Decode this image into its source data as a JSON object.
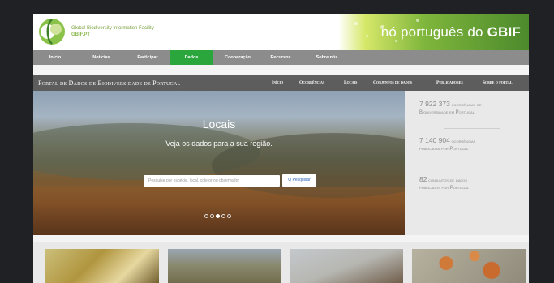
{
  "header": {
    "org_name": "Global Biodiversity Information Facility",
    "org_short": "GBIF.PT",
    "banner_text": "nó português do",
    "banner_brand": "GBIF",
    "colors": {
      "brand_green": "#2aa63c",
      "banner_green": "#4c8a2c"
    }
  },
  "main_nav": {
    "items": [
      {
        "label": "Início"
      },
      {
        "label": "Notícias"
      },
      {
        "label": "Participar"
      },
      {
        "label": "Dados"
      },
      {
        "label": "Cooperação"
      },
      {
        "label": "Recursos"
      },
      {
        "label": "Sobre nós"
      }
    ],
    "active_label": "Dados"
  },
  "portal": {
    "title": "Portal de Dados de Biodiversidade de Portugal",
    "nav": [
      {
        "label": "Início"
      },
      {
        "label": "Ocorrências"
      },
      {
        "label": "Locais"
      },
      {
        "label": "Conjuntos de dados"
      },
      {
        "label": "Publicadores"
      },
      {
        "label": "Sobre o portal"
      }
    ],
    "active_label": "Locais"
  },
  "hero": {
    "title": "Locais",
    "subtitle": "Veja os dados para a sua região.",
    "search_placeholder": "Pesquise por espécie, local, coletor ou observador",
    "search_button": "Q Pesquisar",
    "slide_count": 5,
    "active_slide": 3
  },
  "stats": [
    {
      "number": "7 922 373",
      "line1": "ocorrências de",
      "line2": "Biodiversidade em Portugal"
    },
    {
      "number": "7 140 904",
      "line1": "ocorrências",
      "line2": "publicadas por Portugal"
    },
    {
      "number": "82",
      "line1": "conjuntos de dados",
      "line2": "publicados por Portugal"
    }
  ],
  "cards": [
    {
      "icon": "butterfly-photo"
    },
    {
      "icon": "landscape-photo"
    },
    {
      "icon": "bird-photo"
    },
    {
      "icon": "lichen-photo"
    }
  ]
}
